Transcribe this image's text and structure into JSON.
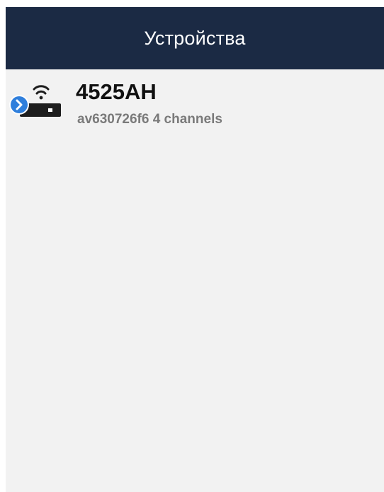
{
  "header": {
    "title": "Устройства",
    "bg_color": "#1b2a44"
  },
  "devices": [
    {
      "name": "4525AH",
      "subtitle": "av630726f6 4 channels",
      "icon": "wifi-router-icon",
      "badge_icon": "chevron-right-circle-icon",
      "badge_color": "#2f7fdc"
    }
  ]
}
